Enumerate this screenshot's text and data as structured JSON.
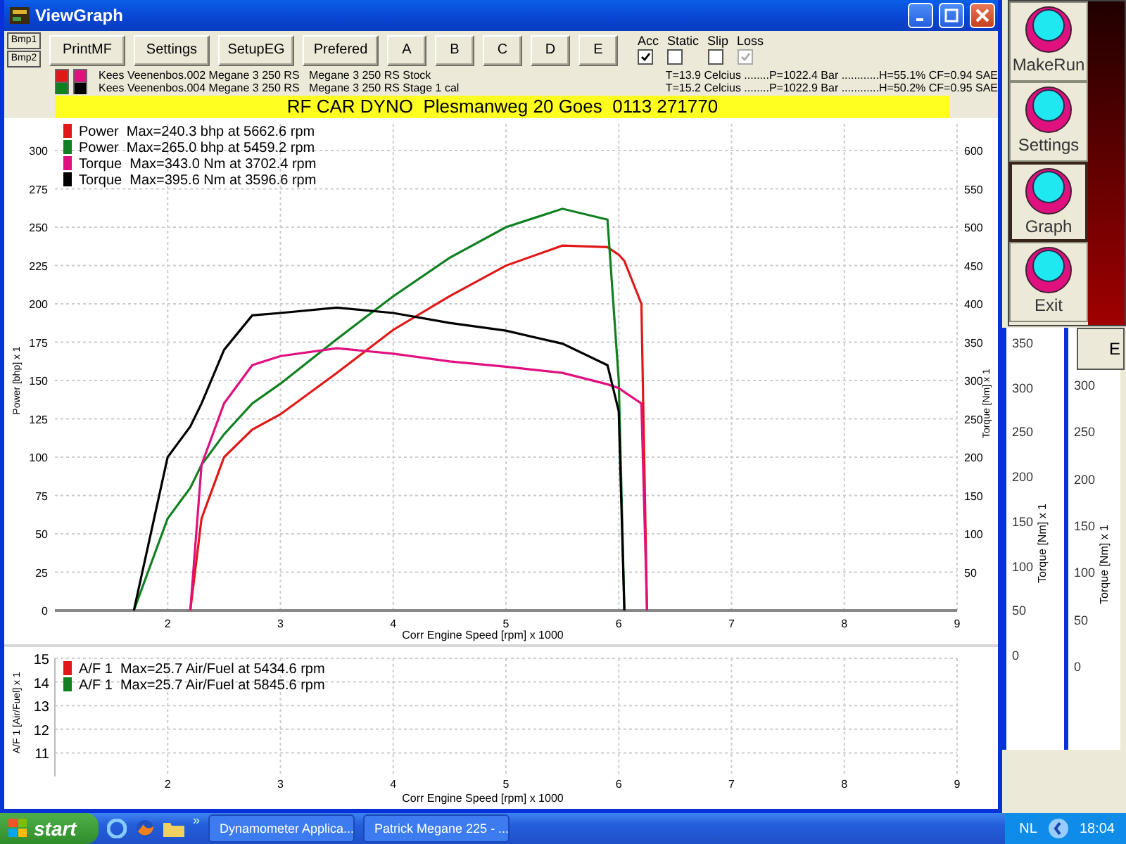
{
  "window": {
    "title": "ViewGraph"
  },
  "bmp_buttons": [
    "Bmp1",
    "Bmp2"
  ],
  "toolbar": [
    "PrintMF",
    "Settings",
    "SetupEG",
    "Prefered",
    "A",
    "B",
    "C",
    "D",
    "E"
  ],
  "options": [
    {
      "label": "Acc",
      "checked": true,
      "disabled": false
    },
    {
      "label": "Static",
      "checked": false,
      "disabled": false
    },
    {
      "label": "Slip",
      "checked": false,
      "disabled": false
    },
    {
      "label": "Loss",
      "checked": true,
      "disabled": true
    }
  ],
  "runs": [
    {
      "swatches": [
        {
          "color": "#e01818"
        },
        {
          "color": "#e0107f"
        }
      ],
      "description": "Kees Veenenbos.002 Megane 3 250 RS   Megane 3 250 RS Stock",
      "conditions": "T=13.9 Celcius ........P=1022.4 Bar ............H=55.1% CF=0.94 SAE"
    },
    {
      "swatches": [
        {
          "color": "#108020"
        },
        {
          "color": "#000000"
        }
      ],
      "description": "Kees Veenenbos.004 Megane 3 250 RS   Megane 3 250 RS Stage 1 cal",
      "conditions": "T=15.2 Celcius ........P=1022.9 Bar ............H=50.2% CF=0.95 SAE"
    }
  ],
  "banner": "RF CAR DYNO  Plesmanweg 20 Goes  0113 271770",
  "graph": {
    "chart_data": {
      "type": "line",
      "xlabel": "Corr Engine Speed [rpm] x 1000",
      "ylabel": "Power [bhp] x 1",
      "y2label": "Torque [Nm] x 1",
      "grid": true,
      "legend": "upper left",
      "xlim": [
        1,
        9
      ],
      "ylim": [
        0,
        300
      ],
      "y2lim": [
        0,
        600
      ],
      "xticks": [
        2,
        3,
        4,
        5,
        6,
        7,
        8,
        9
      ],
      "yticks": [
        0,
        25,
        50,
        75,
        100,
        125,
        150,
        175,
        200,
        225,
        250,
        275,
        300
      ],
      "y2ticks": [
        50,
        100,
        150,
        200,
        250,
        300,
        350,
        400,
        450,
        500,
        550,
        600
      ],
      "x": [
        1.7,
        2,
        2.2,
        2.3,
        2.5,
        2.75,
        3,
        3.5,
        4,
        4.5,
        5,
        5.5,
        5.9,
        6,
        6.05,
        6.2,
        6.25
      ],
      "series": [
        {
          "name": "Power  Max=240.3 bhp at 5662.6 rpm",
          "color": "#e01818",
          "values": [
            null,
            null,
            0,
            60,
            100,
            118,
            128,
            155,
            183,
            205,
            225,
            238,
            237,
            232,
            228,
            200,
            0
          ]
        },
        {
          "name": "Power  Max=265.0 bhp at 5459.2 rpm",
          "color": "#108020",
          "values": [
            0,
            60,
            80,
            95,
            115,
            135,
            148,
            177,
            205,
            230,
            250,
            262,
            255,
            150,
            0,
            null,
            null
          ]
        },
        {
          "name": "Torque  Max=343.0 Nm at 3702.4 rpm",
          "color": "#e0107f",
          "axis": "y2",
          "values": [
            null,
            null,
            0,
            190,
            270,
            320,
            332,
            342,
            335,
            325,
            318,
            310,
            295,
            290,
            285,
            270,
            0
          ]
        },
        {
          "name": "Torque  Max=395.6 Nm at 3596.6 rpm",
          "color": "#000000",
          "axis": "y2",
          "values": [
            0,
            200,
            240,
            270,
            340,
            385,
            388,
            395,
            388,
            375,
            365,
            348,
            320,
            260,
            0,
            null,
            null
          ]
        }
      ]
    }
  },
  "af_graph": {
    "chart_data": {
      "type": "line",
      "ylabel": "A/F 1 [Air/Fuel] x 1",
      "xlabel": "Corr Engine Speed [rpm] x 1000",
      "grid": true,
      "legend": "upper left",
      "categories": [
        "2",
        "3",
        "4",
        "5",
        "6",
        "7",
        "8",
        "9"
      ],
      "ylim": [
        10,
        15
      ],
      "yticks": [
        11,
        12,
        13,
        14,
        15
      ],
      "series": [
        {
          "name": "A/F 1  Max=25.7 Air/Fuel at 5434.6 rpm",
          "color": "#e01818",
          "values": [
            null,
            null,
            null,
            null,
            null,
            null,
            null,
            null
          ]
        },
        {
          "name": "A/F 1  Max=25.7 Air/Fuel at 5845.6 rpm",
          "color": "#108020",
          "values": [
            null,
            null,
            null,
            null,
            null,
            null,
            null,
            null
          ]
        }
      ]
    }
  },
  "side_buttons": [
    {
      "label": "MakeRun",
      "selected": false
    },
    {
      "label": "Settings",
      "selected": false
    },
    {
      "label": "Graph",
      "selected": true
    },
    {
      "label": "Exit",
      "selected": false
    }
  ],
  "background_windows": [
    {
      "yticks": [
        "350",
        "300",
        "250",
        "200",
        "150",
        "100",
        "50",
        "0"
      ],
      "ylabel": "Torque [Nm] x 1"
    },
    {
      "button": "E",
      "yticks": [
        "300",
        "250",
        "200",
        "150",
        "100",
        "50",
        "0"
      ],
      "ylabel": "Torque [Nm] x 1"
    }
  ],
  "taskbar": {
    "start": "start",
    "more": "»",
    "tasks": [
      "Dynamometer Applica...",
      "Patrick Megane 225 - ..."
    ],
    "language": "NL",
    "clock": "18:04"
  }
}
